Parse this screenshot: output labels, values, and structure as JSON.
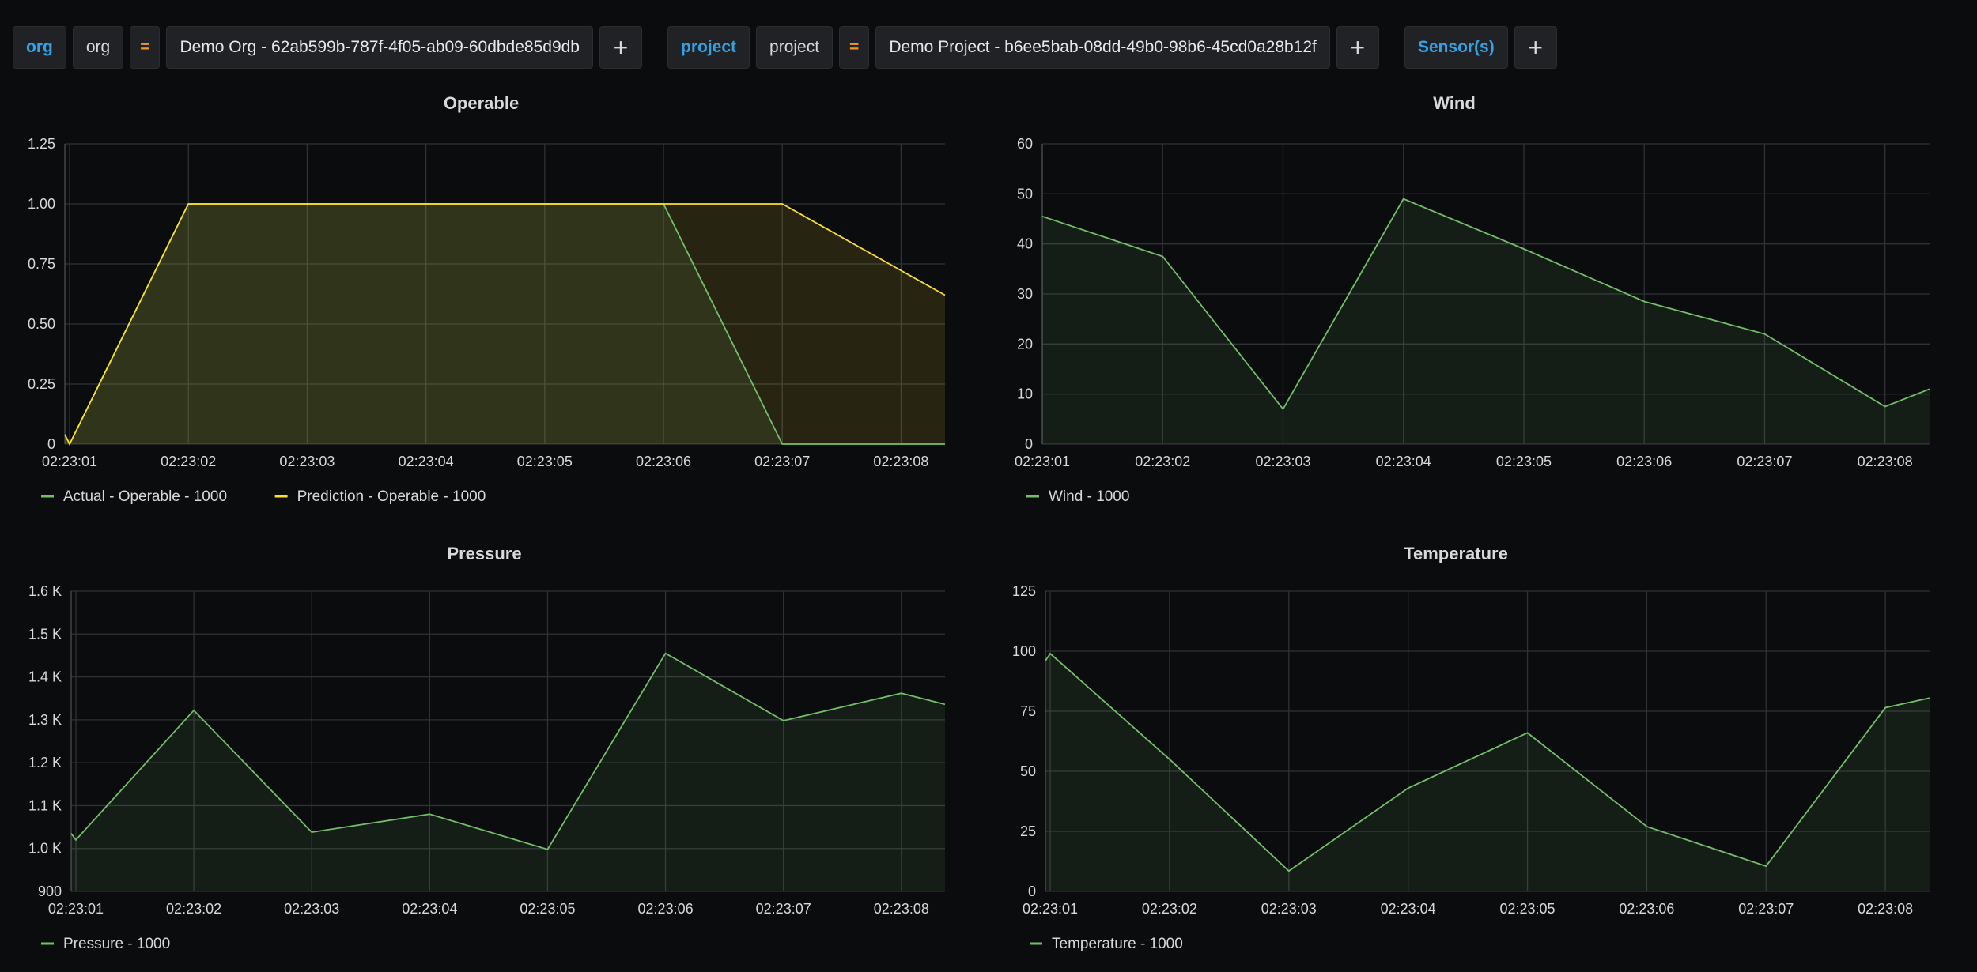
{
  "filters": {
    "org_key": "org",
    "org_field": "org",
    "org_op": "=",
    "org_value": "Demo Org - 62ab599b-787f-4f05-ab09-60dbde85d9db",
    "project_key": "project",
    "project_field": "project",
    "project_op": "=",
    "project_value": "Demo Project - b6ee5bab-08dd-49b0-98b6-45cd0a28b12f",
    "sensor_key": "Sensor(s)",
    "add_symbol": "+"
  },
  "colors": {
    "green": "#73bf69",
    "yellow": "#fade2a",
    "grid": "#2f3136",
    "bg": "#0b0c0e"
  },
  "chart_data": [
    {
      "type": "area",
      "title": "Operable",
      "x": [
        "02:23:01",
        "02:23:02",
        "02:23:03",
        "02:23:04",
        "02:23:05",
        "02:23:06",
        "02:23:07",
        "02:23:08"
      ],
      "x_range": [
        "02:23:00.96",
        "02:23:08.37"
      ],
      "ylim": [
        0,
        1.25
      ],
      "yticks": [
        "0",
        "0.25",
        "0.50",
        "0.75",
        "1.00",
        "1.25"
      ],
      "yticks_values": [
        0,
        0.25,
        0.5,
        0.75,
        1,
        1.25
      ],
      "series": [
        {
          "name": "Actual - Operable - 1000",
          "color": "green",
          "t": [
            -0.04,
            0,
            1,
            2,
            3,
            4,
            5,
            6,
            7.37
          ],
          "values": [
            0.04,
            0,
            1,
            1,
            1,
            1,
            1,
            0,
            0
          ]
        },
        {
          "name": "Prediction - Operable - 1000",
          "color": "yellow",
          "t": [
            -0.04,
            0,
            1,
            2,
            3,
            4,
            5,
            6,
            7.37
          ],
          "values": [
            0.04,
            0,
            1,
            1,
            1,
            1,
            1,
            1,
            0.62
          ]
        }
      ],
      "legend": "bottom-left"
    },
    {
      "type": "area",
      "title": "Wind",
      "x": [
        "02:23:01",
        "02:23:02",
        "02:23:03",
        "02:23:04",
        "02:23:05",
        "02:23:06",
        "02:23:07",
        "02:23:08"
      ],
      "x_range": [
        "02:23:01",
        "02:23:08.37"
      ],
      "ylim": [
        0,
        60
      ],
      "yticks": [
        "0",
        "10",
        "20",
        "30",
        "40",
        "50",
        "60"
      ],
      "yticks_values": [
        0,
        10,
        20,
        30,
        40,
        50,
        60
      ],
      "series": [
        {
          "name": "Wind - 1000",
          "color": "green",
          "t": [
            0,
            1,
            2,
            3,
            4,
            5,
            6,
            7,
            7.37
          ],
          "values": [
            45.5,
            37.5,
            7,
            49,
            39,
            28.5,
            22,
            7.5,
            11
          ]
        }
      ],
      "legend": "bottom-left"
    },
    {
      "type": "area",
      "title": "Pressure",
      "x": [
        "02:23:01",
        "02:23:02",
        "02:23:03",
        "02:23:04",
        "02:23:05",
        "02:23:06",
        "02:23:07",
        "02:23:08"
      ],
      "x_range": [
        "02:23:00.96",
        "02:23:08.37"
      ],
      "ylim": [
        900,
        1600
      ],
      "yticks": [
        "900",
        "1.0 K",
        "1.1 K",
        "1.2 K",
        "1.3 K",
        "1.4 K",
        "1.5 K",
        "1.6 K"
      ],
      "yticks_values": [
        900,
        1000,
        1100,
        1200,
        1300,
        1400,
        1500,
        1600
      ],
      "series": [
        {
          "name": "Pressure - 1000",
          "color": "green",
          "t": [
            -0.04,
            0,
            1,
            2,
            3,
            4,
            5,
            6,
            7,
            7.37
          ],
          "values": [
            1035,
            1020,
            1322,
            1038,
            1080,
            998,
            1455,
            1298,
            1362,
            1336
          ]
        }
      ],
      "legend": "bottom-left"
    },
    {
      "type": "area",
      "title": "Temperature",
      "x": [
        "02:23:01",
        "02:23:02",
        "02:23:03",
        "02:23:04",
        "02:23:05",
        "02:23:06",
        "02:23:07",
        "02:23:08"
      ],
      "x_range": [
        "02:23:00.96",
        "02:23:08.37"
      ],
      "ylim": [
        0,
        125
      ],
      "yticks": [
        "0",
        "25",
        "50",
        "75",
        "100",
        "125"
      ],
      "yticks_values": [
        0,
        25,
        50,
        75,
        100,
        125
      ],
      "series": [
        {
          "name": "Temperature - 1000",
          "color": "green",
          "t": [
            -0.04,
            0,
            1,
            2,
            3,
            4,
            5,
            6,
            7,
            7.37
          ],
          "values": [
            96,
            99,
            55,
            8.5,
            43,
            66,
            27,
            10.5,
            76.5,
            80.5
          ]
        }
      ],
      "legend": "bottom-left"
    }
  ]
}
